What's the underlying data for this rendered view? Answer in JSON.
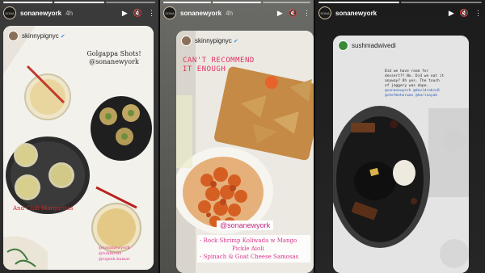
{
  "stories": [
    {
      "account": "sonanewyork",
      "time": "4h",
      "avatar_text": "SONA",
      "shared_account": "skinnypignyc",
      "caption_title": "Golgappa Shots!",
      "caption_handle": "@sonanewyork",
      "caption_footer": "And Chili Margaritas",
      "credits": [
        "@sonanewyork",
        "@tuhinrulz",
        "@rajesh.kumar"
      ]
    },
    {
      "account": "sonanewyork",
      "time": "4h",
      "avatar_text": "SONA",
      "shared_account": "skinnypignyc",
      "headline": "CAN'T RECOMMEND IT ENOUGH",
      "tag": "@sonanewyork",
      "menu_items": [
        "- Rock Shrimp Koliwada w Mango",
        "Pickle Aioli",
        "- Spinach & Goat Cheese Samosas"
      ]
    },
    {
      "account": "sonanewyork",
      "time": "",
      "avatar_text": "SONA",
      "shared_account": "sushmadwivedi",
      "note_lines": [
        "Did we have room for",
        "dessert?? No. Did we eat it",
        "anyway? Uh yes. The touch",
        "of jaggery was dope.",
        "@sonanewyork @davidrabin8",
        "@chefmeherwan @harinayak"
      ]
    }
  ],
  "controls": {
    "play": "▶",
    "mute": "🔇",
    "more": "⋮"
  },
  "colors": {
    "accent_pink": "#d9368b",
    "caption_red": "#c92a2a",
    "verify_blue": "#3897f0"
  }
}
